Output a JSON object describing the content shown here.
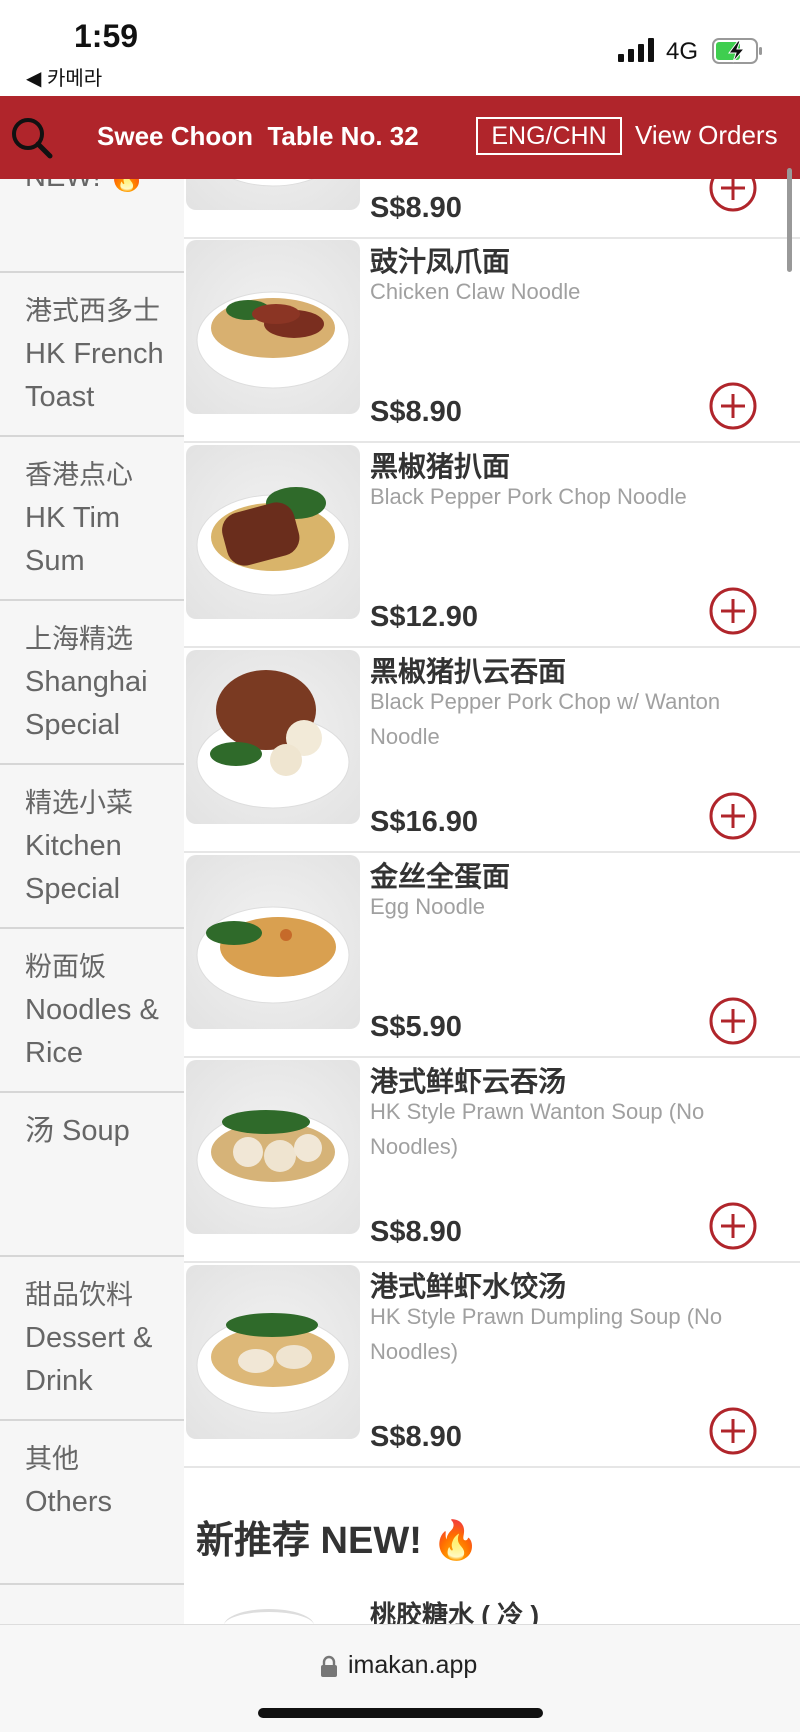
{
  "status_bar": {
    "time": "1:59",
    "back_app": "◀ 카메라",
    "network": "4G"
  },
  "header": {
    "restaurant": "Swee Choon",
    "table": "Table No. 32",
    "lang_button": "ENG/CHN",
    "orders_button": "View Orders",
    "bg_color": "#b0252b"
  },
  "sidebar": {
    "categories": [
      {
        "zh": "",
        "en": "NEW! 🔥"
      },
      {
        "zh": "港式西多士",
        "en": "HK French Toast"
      },
      {
        "zh": "香港点心",
        "en": "HK Tim Sum"
      },
      {
        "zh": "上海精选",
        "en": "Shanghai Special"
      },
      {
        "zh": "精选小菜",
        "en": "Kitchen Special"
      },
      {
        "zh": "粉面饭",
        "en": "Noodles & Rice"
      },
      {
        "zh": "汤 Soup",
        "en": ""
      },
      {
        "zh": "甜品饮料",
        "en": "Dessert & Drink"
      },
      {
        "zh": "其他",
        "en": "Others"
      }
    ]
  },
  "menu": {
    "items": [
      {
        "zh": "",
        "en": "",
        "price": "S$8.90"
      },
      {
        "zh": "豉汁凤爪面",
        "en": "Chicken Claw Noodle",
        "price": "S$8.90"
      },
      {
        "zh": "黑椒猪扒面",
        "en": "Black Pepper Pork Chop Noodle",
        "price": "S$12.90"
      },
      {
        "zh": "黑椒猪扒云吞面",
        "en": "Black Pepper Pork Chop w/ Wanton Noodle",
        "price": "S$16.90"
      },
      {
        "zh": "金丝全蛋面",
        "en": "Egg Noodle",
        "price": "S$5.90"
      },
      {
        "zh": "港式鲜虾云吞汤",
        "en": "HK Style Prawn Wanton Soup (No Noodles)",
        "price": "S$8.90"
      },
      {
        "zh": "港式鲜虾水饺汤",
        "en": "HK Style Prawn Dumpling Soup (No Noodles)",
        "price": "S$8.90"
      }
    ],
    "section_title": "新推荐 NEW! 🔥",
    "peek_item": "桃胶糖水 ( 冷 )"
  },
  "url_bar": {
    "url": "imakan.app"
  },
  "colors": {
    "accent": "#b0252b",
    "add_icon": "#b0252b"
  }
}
